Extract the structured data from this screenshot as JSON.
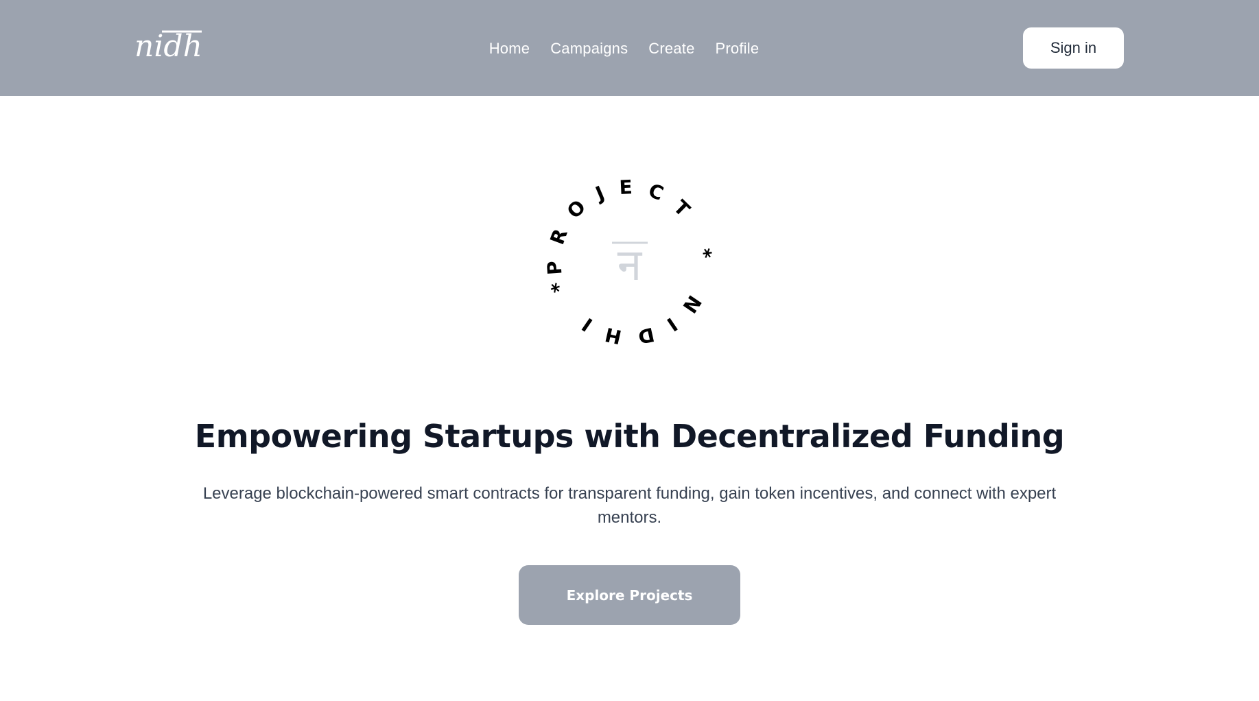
{
  "navbar": {
    "logo_text": "nidhi",
    "links": [
      {
        "label": "Home"
      },
      {
        "label": "Campaigns"
      },
      {
        "label": "Create"
      },
      {
        "label": "Profile"
      }
    ],
    "signin_label": "Sign in"
  },
  "badge": {
    "ring_text": "PROJECT * NIDHI * ",
    "center_glyph": "न"
  },
  "hero": {
    "title": "Empowering Startups with Decentralized Funding",
    "subtitle": "Leverage blockchain-powered smart contracts for transparent funding, gain token incentives, and connect with expert mentors.",
    "cta_label": "Explore Projects"
  },
  "colors": {
    "navbar_bg": "#9ca3af",
    "title": "#111827",
    "subtitle": "#374151",
    "cta_bg": "#9ca3af",
    "badge_text": "#000000",
    "badge_glyph": "#d1d5db"
  }
}
